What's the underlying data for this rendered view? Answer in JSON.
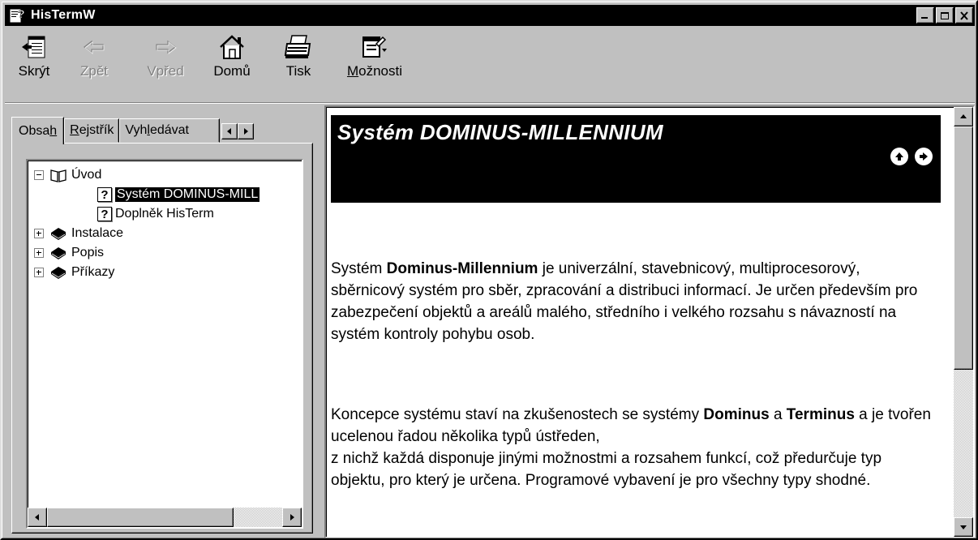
{
  "window": {
    "title": "HisTermW"
  },
  "toolbar": {
    "hide": {
      "label": "Skrýt",
      "icon": "hide-pane-icon"
    },
    "back": {
      "label": "Zpět",
      "icon": "back-arrow-icon",
      "enabled": false
    },
    "forward": {
      "label": "Vpřed",
      "icon": "forward-arrow-icon",
      "enabled": false
    },
    "home": {
      "label": "Domů",
      "icon": "home-icon"
    },
    "print": {
      "label": "Tisk",
      "icon": "printer-icon"
    },
    "options": {
      "label_underlined": "M",
      "label_rest": "ožnosti",
      "icon": "options-icon"
    }
  },
  "tabs": {
    "contents": {
      "pre": "Obsa",
      "ul": "h",
      "post": ""
    },
    "index": {
      "pre": "",
      "ul": "R",
      "post": "ejstřík"
    },
    "search": {
      "pre": "Vyh",
      "ul": "l",
      "post": "edávat"
    }
  },
  "tree": [
    {
      "label": "Úvod",
      "icon": "open-book-icon",
      "expanded": true
    },
    {
      "label": "Systém DOMINUS-MILL",
      "icon": "help-topic-icon",
      "selected": true
    },
    {
      "label": "Doplněk HisTerm",
      "icon": "help-topic-icon"
    },
    {
      "label": "Instalace",
      "icon": "closed-book-icon",
      "expanded": false
    },
    {
      "label": "Popis",
      "icon": "closed-book-icon",
      "expanded": false
    },
    {
      "label": "Příkazy",
      "icon": "closed-book-icon",
      "expanded": false
    }
  ],
  "content": {
    "heading": "Systém DOMINUS-MILLENNIUM",
    "p1_a": "Systém ",
    "p1_b": "Dominus-Millennium",
    "p1_c": " je univerzální, stavebnicový, multiprocesorový, sběrnicový systém pro sběr, zpracování a distribuci informací. Je určen především pro zabezpečení objektů a areálů malého, středního i velkého rozsahu s návazností na systém kontroly pohybu osob.",
    "p2_a": "Koncepce systému staví na zkušenostech se systémy ",
    "p2_b": "Dominus",
    "p2_c": " a ",
    "p2_d": "Terminus",
    "p2_e": " a je tvořen ucelenou řadou několika typů ústředen,",
    "p2_f": "z nichž každá disponuje jinými možnostmi a rozsahem funkcí, což předurčuje typ objektu, pro který je určena. Programové vybavení je pro všechny typy shodné."
  }
}
